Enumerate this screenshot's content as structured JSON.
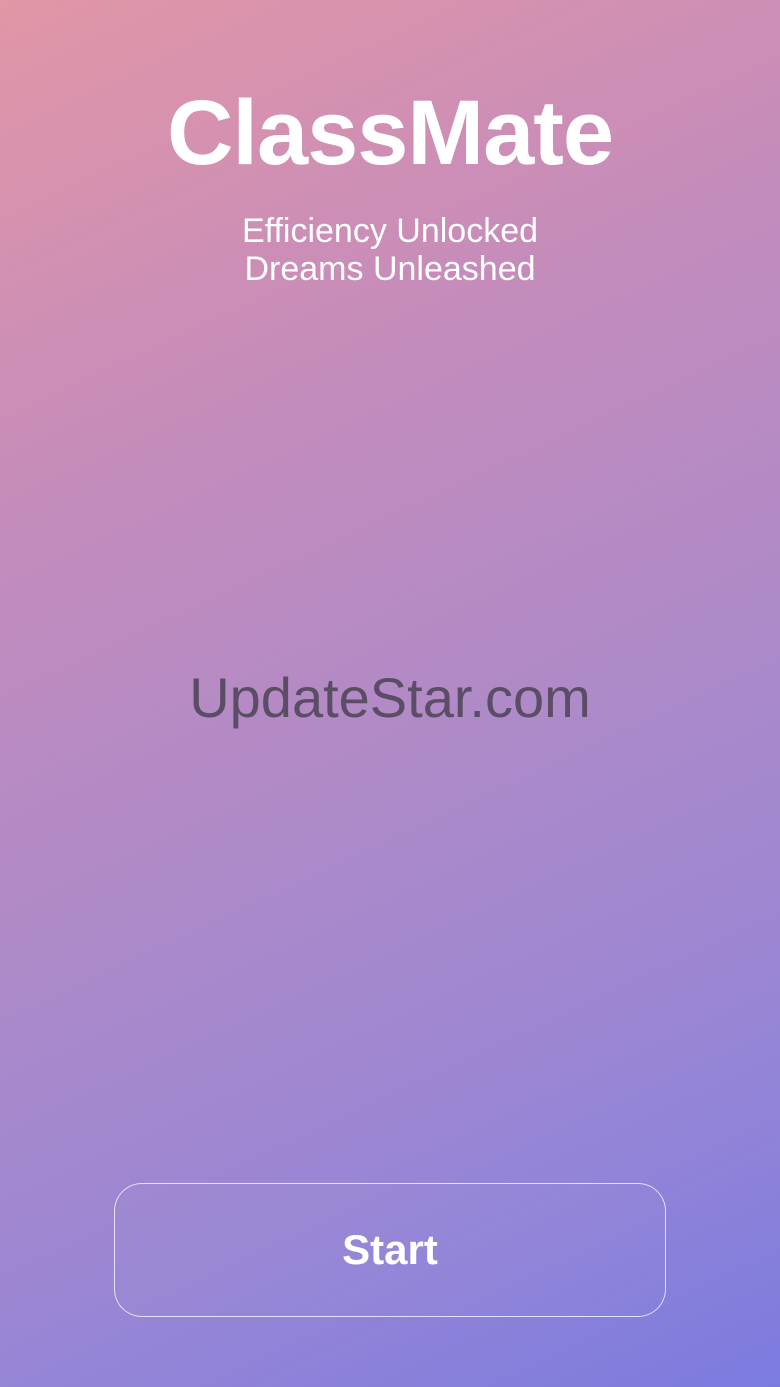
{
  "app": {
    "title": "ClassMate",
    "tagline_line1": "Efficiency Unlocked",
    "tagline_line2": "Dreams Unleashed"
  },
  "watermark": {
    "text": "UpdateStar.com"
  },
  "actions": {
    "start_label": "Start"
  },
  "colors": {
    "gradient_top_left": "#e296a6",
    "gradient_bottom_right": "#7b7bdf",
    "text": "#ffffff",
    "watermark": "#5b4d66"
  }
}
